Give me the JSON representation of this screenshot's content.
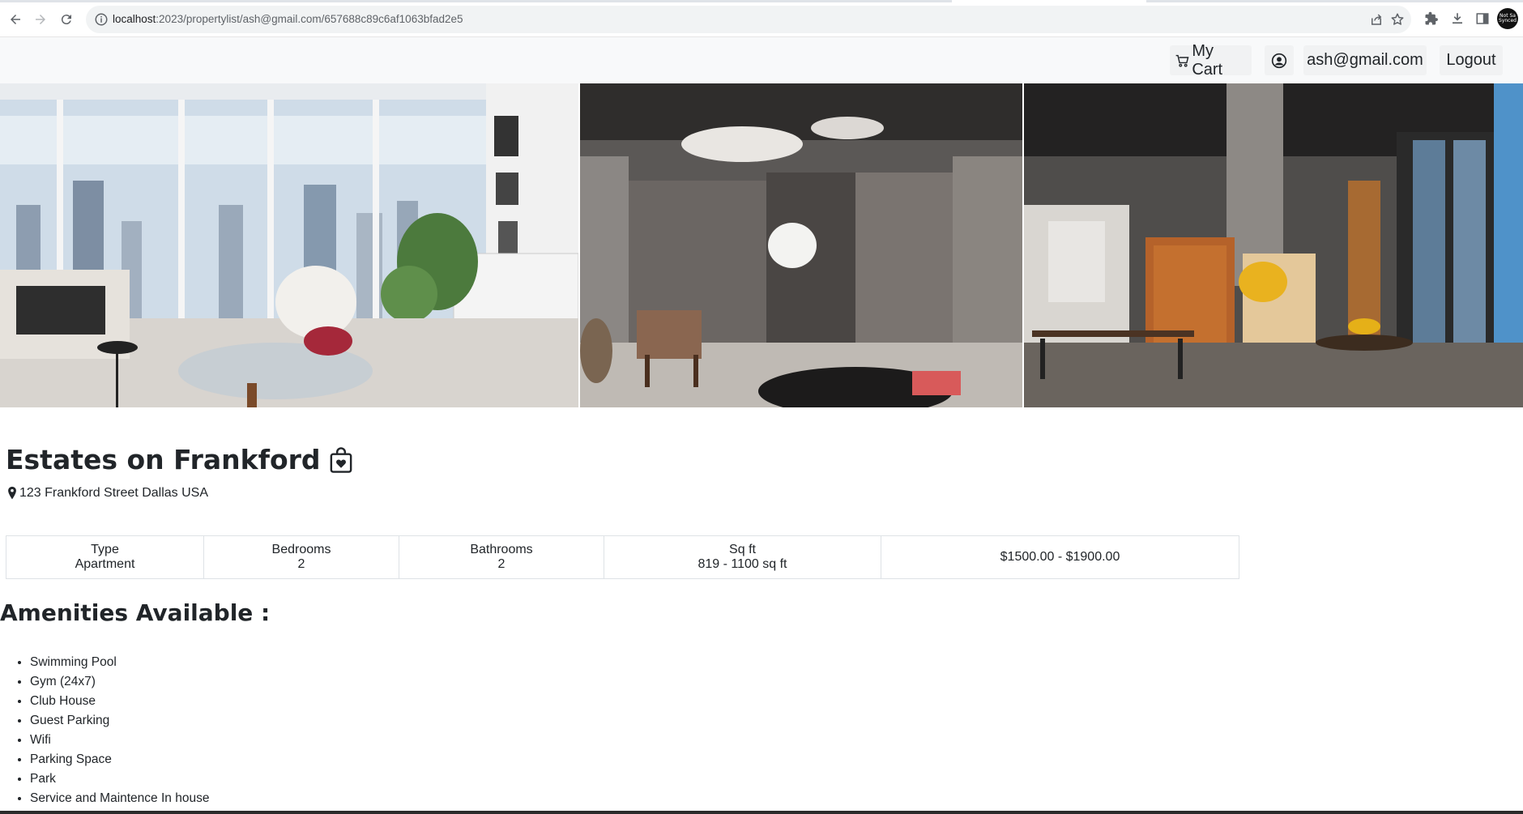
{
  "browser": {
    "url_host": "localhost",
    "url_path": ":2023/propertylist/ash@gmail.com/657688c89c6af1063bfad2e5",
    "profile_text": "Not Sa Synced"
  },
  "navbar": {
    "cart_label": "My Cart",
    "user_email": "ash@gmail.com",
    "logout_label": "Logout"
  },
  "gallery": {
    "photos": [
      "Living room with city view",
      "Dark modern interior",
      "Loft office with windows"
    ]
  },
  "property": {
    "name": "Estates on Frankford",
    "address": "123 Frankford Street Dallas USA",
    "details": {
      "type_label": "Type",
      "type_value": "Apartment",
      "bedrooms_label": "Bedrooms",
      "bedrooms_value": "2",
      "bathrooms_label": "Bathrooms",
      "bathrooms_value": "2",
      "sqft_label": "Sq ft",
      "sqft_value": "819 - 1100 sq ft",
      "price": "$1500.00 - $1900.00"
    }
  },
  "amenities": {
    "heading": "Amenities Available :",
    "items": [
      "Swimming Pool",
      "Gym (24x7)",
      "Club House",
      "Guest Parking",
      "Wifi",
      "Parking Space",
      "Park",
      "Service and Maintence In house"
    ]
  }
}
